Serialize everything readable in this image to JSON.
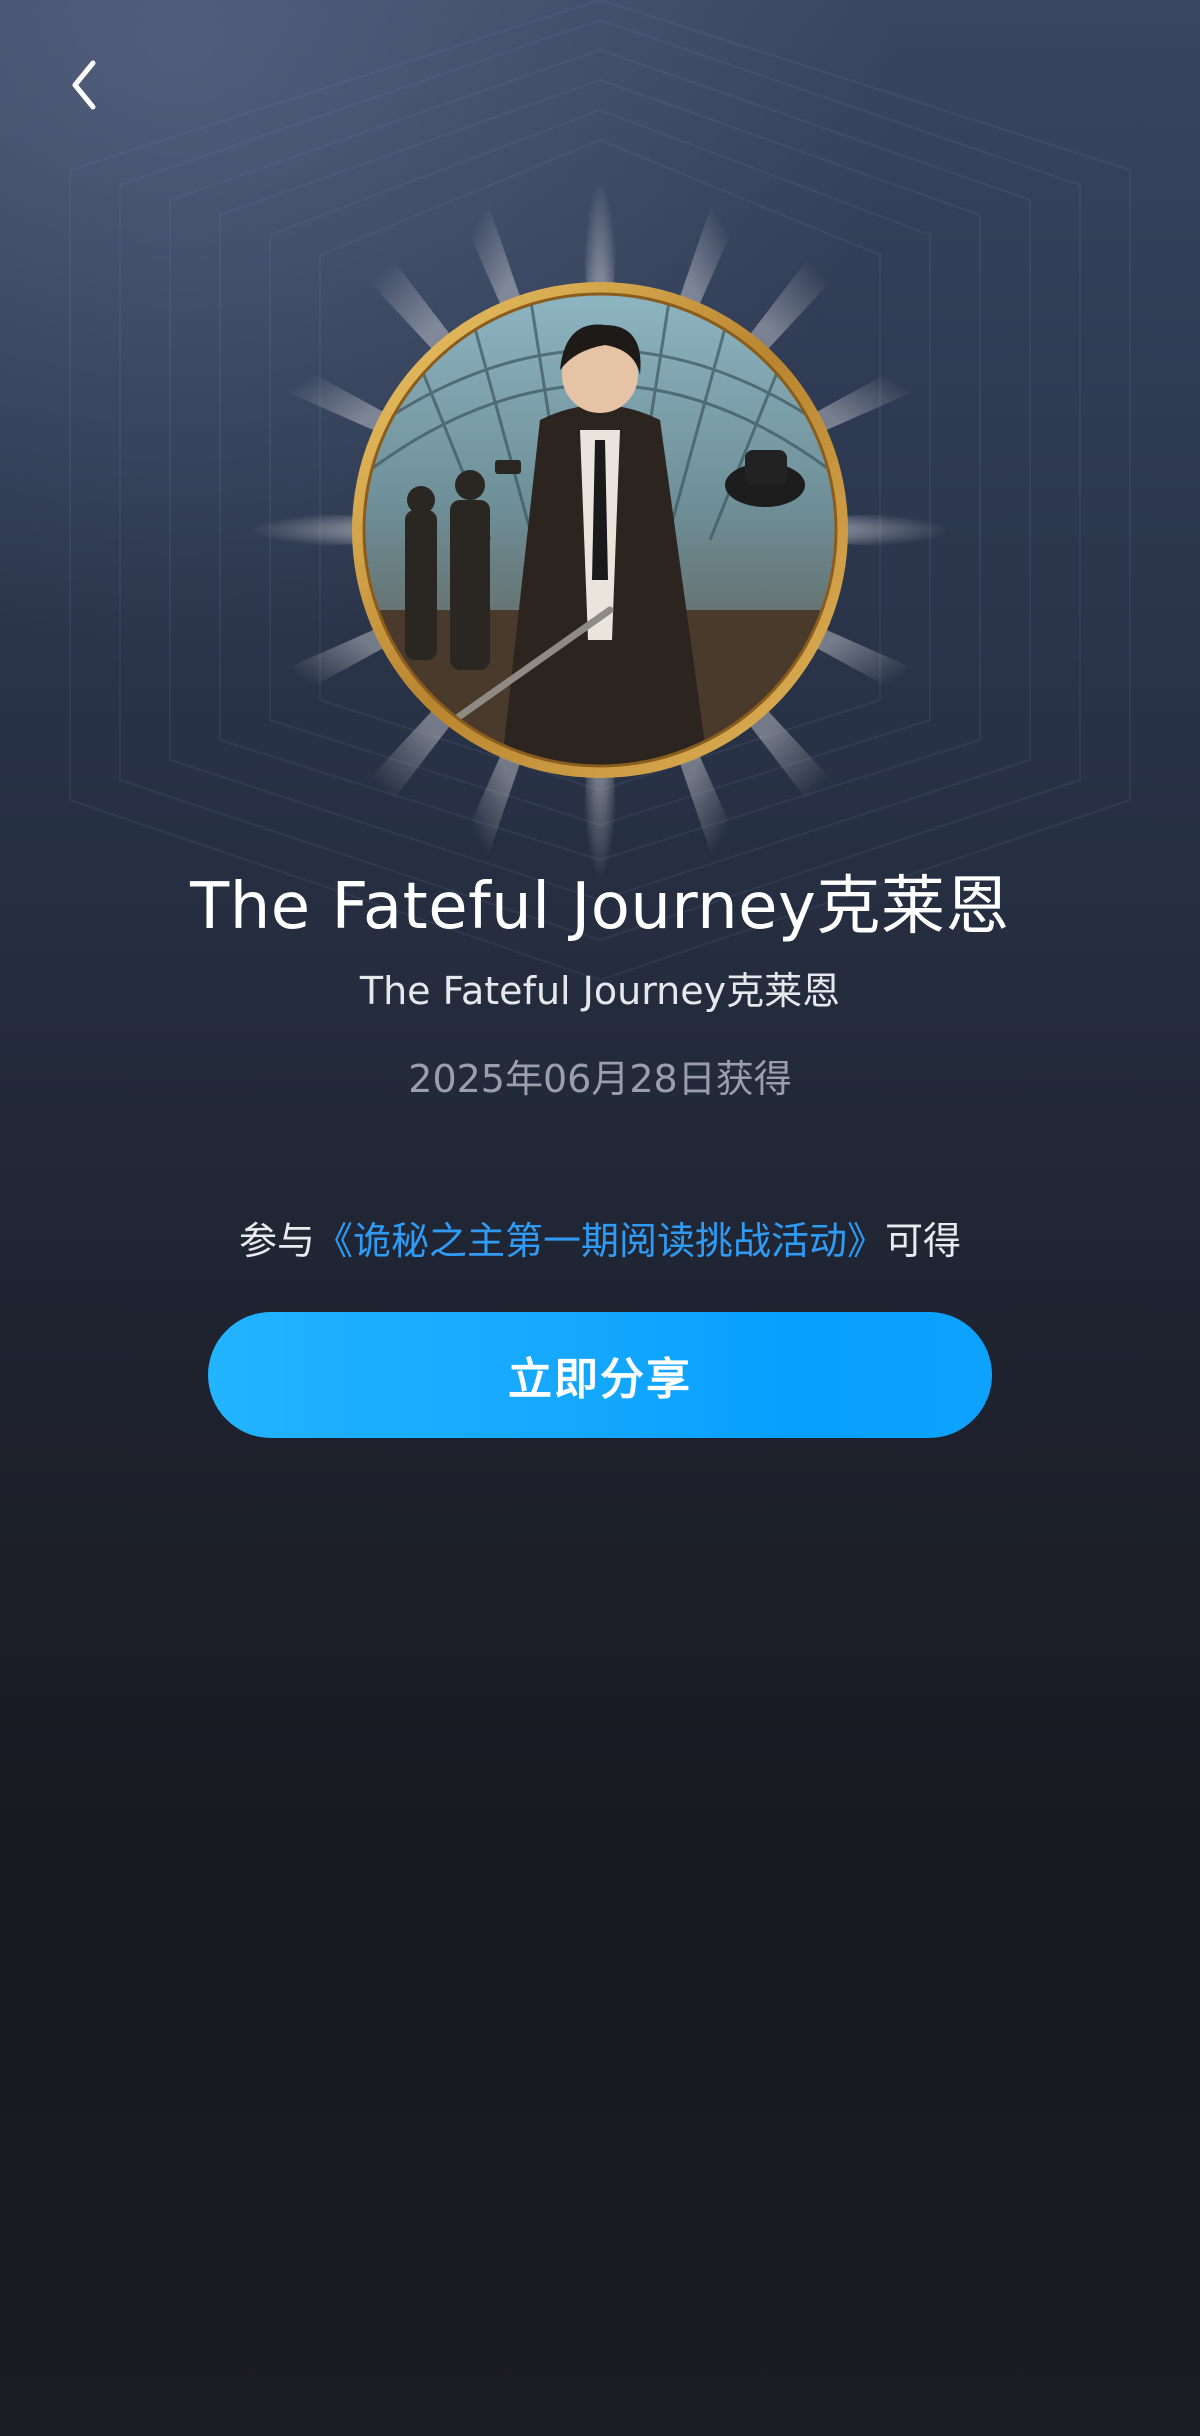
{
  "badge": {
    "title": "The Fateful Journey克莱恩",
    "subtitle": "The Fateful Journey克莱恩",
    "obtained_date": "2025年06月28日获得"
  },
  "source": {
    "prefix": "参与",
    "activity_link": "《诡秘之主第一期阅读挑战活动》",
    "suffix": "可得"
  },
  "actions": {
    "share_label": "立即分享",
    "back_icon": "chevron-left-icon"
  },
  "colors": {
    "accent": "#1aa8ff",
    "link": "#2f9bf5",
    "medal_rim": "#d4a24c"
  }
}
